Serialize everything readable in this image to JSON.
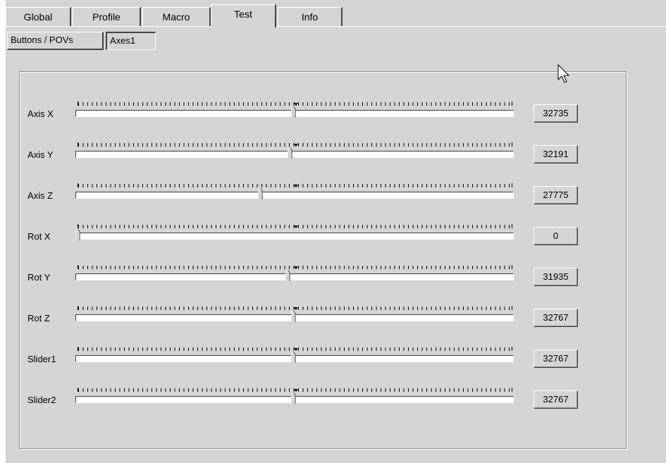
{
  "main_tabs": [
    {
      "label": "Global",
      "active": false
    },
    {
      "label": "Profile",
      "active": false
    },
    {
      "label": "Macro",
      "active": false
    },
    {
      "label": "Test",
      "active": true
    },
    {
      "label": "Info",
      "active": false
    }
  ],
  "sub_tabs": [
    {
      "label": "Buttons / POVs",
      "active": false
    },
    {
      "label": "Axes1",
      "active": true
    }
  ],
  "axes": [
    {
      "label": "Axis X",
      "value": "32735",
      "raw": 32735
    },
    {
      "label": "Axis Y",
      "value": "32191",
      "raw": 32191
    },
    {
      "label": "Axis Z",
      "value": "27775",
      "raw": 27775
    },
    {
      "label": "Rot X",
      "value": "0",
      "raw": 0
    },
    {
      "label": "Rot Y",
      "value": "31935",
      "raw": 31935
    },
    {
      "label": "Rot Z",
      "value": "32767",
      "raw": 32767
    },
    {
      "label": "Slider1",
      "value": "32767",
      "raw": 32767
    },
    {
      "label": "Slider2",
      "value": "32767",
      "raw": 32767
    }
  ],
  "axis_max": 65535
}
